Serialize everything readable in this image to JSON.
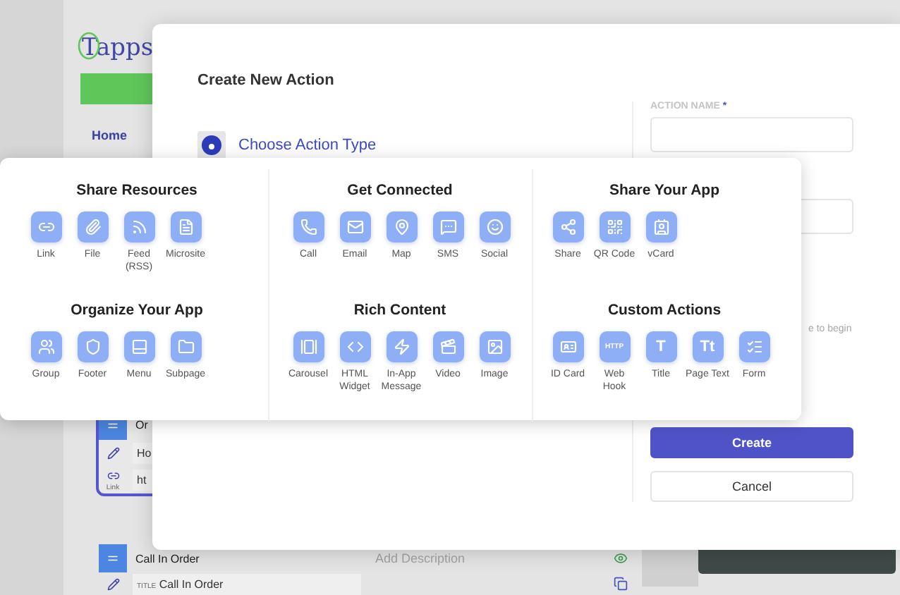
{
  "app": {
    "logo": "Tapps",
    "nav": [
      {
        "label": "Home",
        "selected": true
      }
    ],
    "rows": [
      {
        "title": "Or",
        "field_1": "Ho",
        "field_2": "ht",
        "type_label": "Link",
        "selected": true
      },
      {
        "title": "Call In Order",
        "description_placeholder": "Add Description",
        "field_label": "TITLE",
        "field_value": "Call In Order",
        "selected": false
      }
    ]
  },
  "modal": {
    "title": "Create New Action",
    "choose_label": "Choose Action Type",
    "action_name": {
      "label": "ACTION NAME",
      "required_mark": "*"
    },
    "hint": "e to begin",
    "buttons": [
      {
        "label": "Create",
        "kind": "primary"
      },
      {
        "label": "Cancel",
        "kind": "secondary"
      }
    ]
  },
  "picker": {
    "columns": [
      {
        "sections": [
          {
            "title": "Share Resources",
            "items": [
              {
                "label": "Link"
              },
              {
                "label": "File"
              },
              {
                "label": "Feed\n(RSS)"
              },
              {
                "label": "Microsite"
              }
            ]
          },
          {
            "title": "Organize Your App",
            "items": [
              {
                "label": "Group"
              },
              {
                "label": "Footer"
              },
              {
                "label": "Menu"
              },
              {
                "label": "Subpage"
              }
            ]
          }
        ]
      },
      {
        "sections": [
          {
            "title": "Get Connected",
            "items": [
              {
                "label": "Call"
              },
              {
                "label": "Email"
              },
              {
                "label": "Map"
              },
              {
                "label": "SMS"
              },
              {
                "label": "Social"
              }
            ]
          },
          {
            "title": "Rich Content",
            "items": [
              {
                "label": "Carousel"
              },
              {
                "label": "HTML\nWidget"
              },
              {
                "label": "In-App\nMessage"
              },
              {
                "label": "Video"
              },
              {
                "label": "Image"
              }
            ]
          }
        ]
      },
      {
        "sections": [
          {
            "title": "Share Your App",
            "items": [
              {
                "label": "Share"
              },
              {
                "label": "QR Code"
              },
              {
                "label": "vCard"
              }
            ]
          },
          {
            "title": "Custom Actions",
            "items": [
              {
                "label": "ID Card"
              },
              {
                "label": "Web\nHook",
                "glyph": "HTTP"
              },
              {
                "label": "Title",
                "glyph": "T"
              },
              {
                "label": "Page Text",
                "glyph": "Tt"
              },
              {
                "label": "Form"
              }
            ]
          }
        ]
      }
    ]
  }
}
